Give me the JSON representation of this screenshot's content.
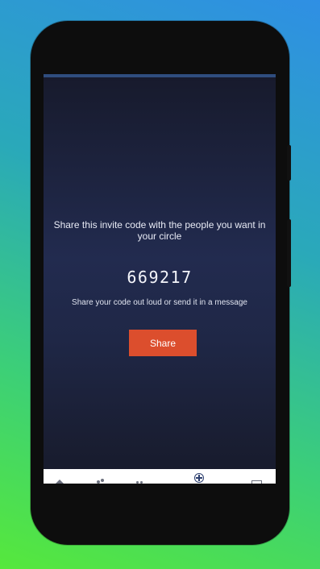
{
  "invite": {
    "message": "Share this invite code with the people you want in your circle",
    "code": "669217",
    "hint": "Share your code out loud or send it in a message",
    "share_label": "Share"
  },
  "colors": {
    "accent": "#dc4e2d",
    "screen_top": "#171a2c",
    "screen_mid": "#222b4f",
    "status_strip": "#2f4d7e"
  },
  "bottom_nav": {
    "items": [
      {
        "icon": "home-icon"
      },
      {
        "icon": "people-icon"
      },
      {
        "icon": "circle-members-icon"
      },
      {
        "icon": "add-circle-icon",
        "active": true
      },
      {
        "icon": "map-icon"
      }
    ]
  }
}
